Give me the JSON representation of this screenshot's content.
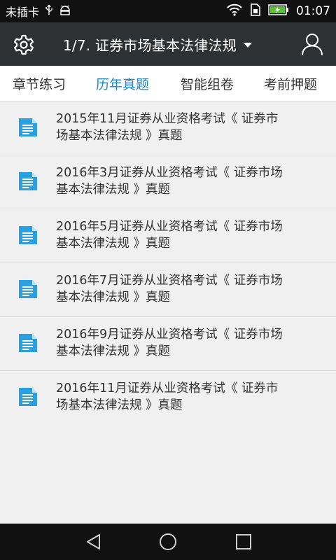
{
  "status_bar": {
    "carrier": "未插卡",
    "time": "01:07",
    "icons": [
      "usb-icon",
      "android-debug-icon",
      "wifi-icon",
      "sim-icon",
      "battery-charging-icon"
    ]
  },
  "app_bar": {
    "title": "1/7. 证券市场基本法律法规",
    "icons": [
      "gear-icon",
      "caret-down-icon",
      "user-icon"
    ]
  },
  "tabs": [
    {
      "label": "章节练习",
      "active": false
    },
    {
      "label": "历年真题",
      "active": true
    },
    {
      "label": "智能组卷",
      "active": false
    },
    {
      "label": "考前押题",
      "active": false
    }
  ],
  "papers": [
    {
      "line1": "2015年11月证券从业资格考试《 证券市",
      "line2": "场基本法律法规 》真题"
    },
    {
      "line1": "2016年3月证券从业资格考试《 证券市场",
      "line2": "基本法律法规 》真题"
    },
    {
      "line1": "2016年5月证券从业资格考试《 证券市场",
      "line2": "基本法律法规 》真题"
    },
    {
      "line1": "2016年7月证券从业资格考试《 证券市场",
      "line2": "基本法律法规 》真题"
    },
    {
      "line1": "2016年9月证券从业资格考试《 证券市场",
      "line2": "基本法律法规 》真题"
    },
    {
      "line1": "2016年11月证券从业资格考试《 证券市",
      "line2": "场基本法律法规 》真题"
    }
  ],
  "colors": {
    "accent": "#1e88d6",
    "app_bar": "#2e3133",
    "doc_icon": "#2aa0e0",
    "battery": "#5ec03a"
  },
  "nav_bar": {
    "icons": [
      "back-icon",
      "home-icon",
      "recents-icon"
    ]
  }
}
